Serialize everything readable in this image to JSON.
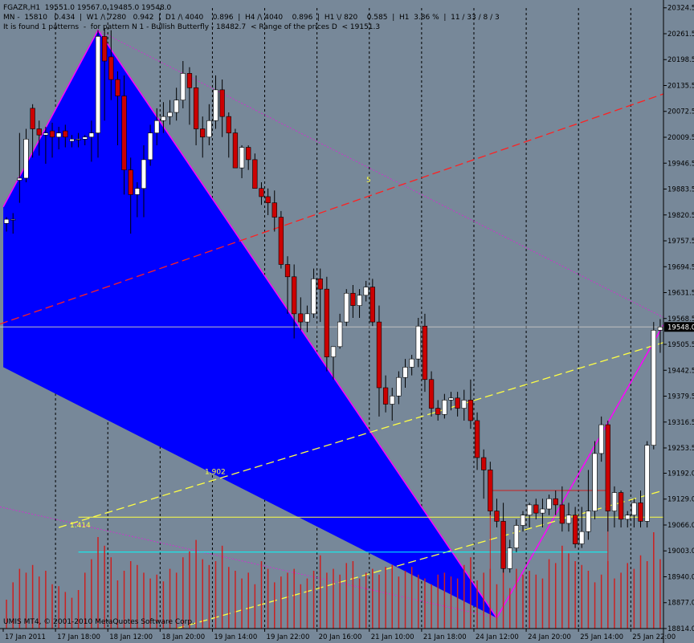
{
  "header": {
    "line1": "FGAZR,H1  19551.0 19567.0 19485.0 19548.0",
    "line2": "MN -  15810   0.434  |  W1 /\\ 7280   0.942  |  D1 /\\ 4040    0.896  |  H4 /\\ 4040    0.896  |  H1 \\/ 820    0.585  |  H1  3.86 %  |  11 / 33 / 8 / 3",
    "line3": "It is found 1 patterns  -  for pattern N 1 - Bullish Butterfly - 18482.7  < Range of the prices D  < 19151.3"
  },
  "copyright": "UMIS MT4, © 2001-2010 MetaQuotes Software Corp.",
  "annotations": {
    "fib_1": "1.902",
    "fib_2": "1.414",
    "point_5": "5"
  },
  "colors": {
    "background": "#778899",
    "bull": "#FFFFFF",
    "bear": "#CC0000",
    "pattern": "#0000FF",
    "pattern_edge": "#FF00FF",
    "red_trend": "#FF2020",
    "yellow": "#FFFF44",
    "cyan": "#00FFFF",
    "volume": "#CC2020",
    "price_tag_bg": "#000000"
  },
  "chart_data": {
    "type": "candlestick",
    "symbol": "FGAZR",
    "timeframe": "H1",
    "ylim": [
      18814,
      20324
    ],
    "current_price": 19548.0,
    "yticks": [
      "20324.5",
      "20261.5",
      "20198.5",
      "20135.5",
      "20072.5",
      "20009.5",
      "19946.5",
      "19883.5",
      "19820.5",
      "19757.5",
      "19694.5",
      "19631.5",
      "19568.5",
      "19505.5",
      "19442.5",
      "19379.5",
      "19316.5",
      "19253.5",
      "19192.0",
      "19129.0",
      "19066.0",
      "19003.0",
      "18940.0",
      "18877.0",
      "18814.0"
    ],
    "price_tag": "19548.0",
    "xticks": [
      {
        "label": "17 Jan 2011",
        "index": 0
      },
      {
        "label": "17 Jan 18:00",
        "index": 8
      },
      {
        "label": "18 Jan 12:00",
        "index": 16
      },
      {
        "label": "18 Jan 20:00",
        "index": 24
      },
      {
        "label": "19 Jan 14:00",
        "index": 32
      },
      {
        "label": "19 Jan 22:00",
        "index": 40
      },
      {
        "label": "20 Jan 16:00",
        "index": 48
      },
      {
        "label": "21 Jan 10:00",
        "index": 56
      },
      {
        "label": "21 Jan 18:00",
        "index": 64
      },
      {
        "label": "24 Jan 12:00",
        "index": 72
      },
      {
        "label": "24 Jan 20:00",
        "index": 80
      },
      {
        "label": "25 Jan 14:00",
        "index": 88
      },
      {
        "label": "25 Jan 22:00",
        "index": 96
      }
    ],
    "candles": [
      [
        19800,
        19815,
        19780,
        19810
      ],
      [
        19810,
        19825,
        19775,
        19810
      ],
      [
        19905,
        20020,
        19850,
        19910
      ],
      [
        19910,
        20030,
        19900,
        20005
      ],
      [
        20080,
        20090,
        19960,
        20030
      ],
      [
        20030,
        20050,
        19965,
        20015
      ],
      [
        20015,
        20035,
        19945,
        20020
      ],
      [
        20025,
        20045,
        19960,
        20010
      ],
      [
        20010,
        20035,
        19980,
        20020
      ],
      [
        20025,
        20040,
        19985,
        20010
      ],
      [
        20000,
        20015,
        19985,
        20005
      ],
      [
        20005,
        20020,
        19985,
        20005
      ],
      [
        20005,
        20015,
        19990,
        20010
      ],
      [
        20010,
        20050,
        19950,
        20020
      ],
      [
        20020,
        20270,
        19960,
        20255
      ],
      [
        20255,
        20275,
        20050,
        20195
      ],
      [
        20205,
        20270,
        20100,
        20150
      ],
      [
        20150,
        20170,
        19990,
        20110
      ],
      [
        20110,
        20160,
        19870,
        19930
      ],
      [
        19930,
        19960,
        19775,
        19870
      ],
      [
        19870,
        19900,
        19815,
        19885
      ],
      [
        19885,
        19990,
        19815,
        19955
      ],
      [
        19955,
        20040,
        19940,
        20020
      ],
      [
        20020,
        20080,
        19990,
        20050
      ],
      [
        20050,
        20095,
        20020,
        20060
      ],
      [
        20060,
        20100,
        20040,
        20070
      ],
      [
        20070,
        20130,
        20050,
        20100
      ],
      [
        20100,
        20195,
        20080,
        20165
      ],
      [
        20165,
        20180,
        20040,
        20130
      ],
      [
        20130,
        20160,
        19990,
        20030
      ],
      [
        20030,
        20060,
        19960,
        20010
      ],
      [
        20010,
        20090,
        19990,
        20050
      ],
      [
        20050,
        20160,
        20030,
        20125
      ],
      [
        20125,
        20150,
        20010,
        20060
      ],
      [
        20060,
        20070,
        19960,
        20020
      ],
      [
        20020,
        20030,
        19960,
        19935
      ],
      [
        19935,
        19990,
        19910,
        19985
      ],
      [
        19985,
        19990,
        19930,
        19955
      ],
      [
        19955,
        19970,
        19890,
        19885
      ],
      [
        19885,
        19900,
        19845,
        19865
      ],
      [
        19865,
        19885,
        19820,
        19850
      ],
      [
        19850,
        19880,
        19780,
        19815
      ],
      [
        19815,
        19830,
        19690,
        19700
      ],
      [
        19700,
        19720,
        19580,
        19670
      ],
      [
        19670,
        19700,
        19520,
        19580
      ],
      [
        19580,
        19620,
        19540,
        19560
      ],
      [
        19560,
        19600,
        19535,
        19580
      ],
      [
        19580,
        19690,
        19570,
        19665
      ],
      [
        19665,
        19690,
        19560,
        19640
      ],
      [
        19640,
        19670,
        19440,
        19475
      ],
      [
        19475,
        19500,
        19420,
        19500
      ],
      [
        19500,
        19580,
        19495,
        19560
      ],
      [
        19560,
        19640,
        19550,
        19630
      ],
      [
        19630,
        19650,
        19570,
        19600
      ],
      [
        19600,
        19640,
        19570,
        19625
      ],
      [
        19625,
        19660,
        19610,
        19645
      ],
      [
        19645,
        19665,
        19550,
        19560
      ],
      [
        19560,
        19600,
        19330,
        19400
      ],
      [
        19400,
        19430,
        19340,
        19360
      ],
      [
        19360,
        19400,
        19320,
        19380
      ],
      [
        19380,
        19440,
        19360,
        19425
      ],
      [
        19425,
        19470,
        19400,
        19450
      ],
      [
        19450,
        19480,
        19430,
        19470
      ],
      [
        19470,
        19570,
        19450,
        19550
      ],
      [
        19550,
        19580,
        19390,
        19420
      ],
      [
        19420,
        19440,
        19330,
        19350
      ],
      [
        19350,
        19370,
        19320,
        19335
      ],
      [
        19335,
        19385,
        19325,
        19370
      ],
      [
        19370,
        19390,
        19345,
        19375
      ],
      [
        19375,
        19390,
        19330,
        19350
      ],
      [
        19350,
        19395,
        19320,
        19370
      ],
      [
        19370,
        19420,
        19300,
        19320
      ],
      [
        19320,
        19340,
        19200,
        19230
      ],
      [
        19230,
        19250,
        19130,
        19200
      ],
      [
        19200,
        19220,
        19090,
        19100
      ],
      [
        19100,
        19130,
        19060,
        19075
      ],
      [
        19075,
        19120,
        18950,
        18960
      ],
      [
        18960,
        19030,
        18950,
        19010
      ],
      [
        19010,
        19080,
        19000,
        19065
      ],
      [
        19065,
        19100,
        19050,
        19090
      ],
      [
        19090,
        19120,
        19060,
        19115
      ],
      [
        19115,
        19130,
        19080,
        19095
      ],
      [
        19095,
        19130,
        19060,
        19105
      ],
      [
        19105,
        19140,
        19090,
        19130
      ],
      [
        19130,
        19150,
        19090,
        19115
      ],
      [
        19115,
        19160,
        19050,
        19070
      ],
      [
        19070,
        19120,
        19050,
        19090
      ],
      [
        19090,
        19110,
        19010,
        19020
      ],
      [
        19020,
        19110,
        19010,
        19050
      ],
      [
        19050,
        19200,
        19030,
        19100
      ],
      [
        19100,
        19270,
        19080,
        19240
      ],
      [
        19240,
        19330,
        19220,
        19310
      ],
      [
        19310,
        19320,
        19050,
        19100
      ],
      [
        19100,
        19160,
        19060,
        19145
      ],
      [
        19145,
        19150,
        19060,
        19080
      ],
      [
        19080,
        19100,
        19060,
        19090
      ],
      [
        19090,
        19130,
        19060,
        19120
      ],
      [
        19120,
        19150,
        19060,
        19075
      ],
      [
        19075,
        19270,
        19060,
        19260
      ],
      [
        19260,
        19560,
        19250,
        19540
      ],
      [
        19540,
        19567,
        19485,
        19548
      ]
    ],
    "volumes": [
      30,
      48,
      62,
      58,
      66,
      54,
      60,
      46,
      44,
      38,
      32,
      40,
      58,
      72,
      95,
      86,
      74,
      50,
      60,
      70,
      66,
      58,
      52,
      56,
      49,
      62,
      58,
      74,
      80,
      92,
      72,
      66,
      70,
      86,
      64,
      60,
      52,
      58,
      46,
      70,
      62,
      48,
      54,
      58,
      62,
      46,
      52,
      60,
      76,
      58,
      62,
      56,
      68,
      70,
      52,
      58,
      62,
      56,
      64,
      66,
      54,
      60,
      64,
      56,
      52,
      46,
      56,
      58,
      54,
      52,
      66,
      74,
      50,
      58,
      62,
      46,
      64,
      42,
      62,
      56,
      60,
      56,
      52,
      72,
      68,
      86,
      78,
      70,
      66,
      60,
      48,
      56,
      70,
      52,
      58,
      68,
      62,
      76,
      70,
      100,
      72,
      58,
      50
    ]
  }
}
